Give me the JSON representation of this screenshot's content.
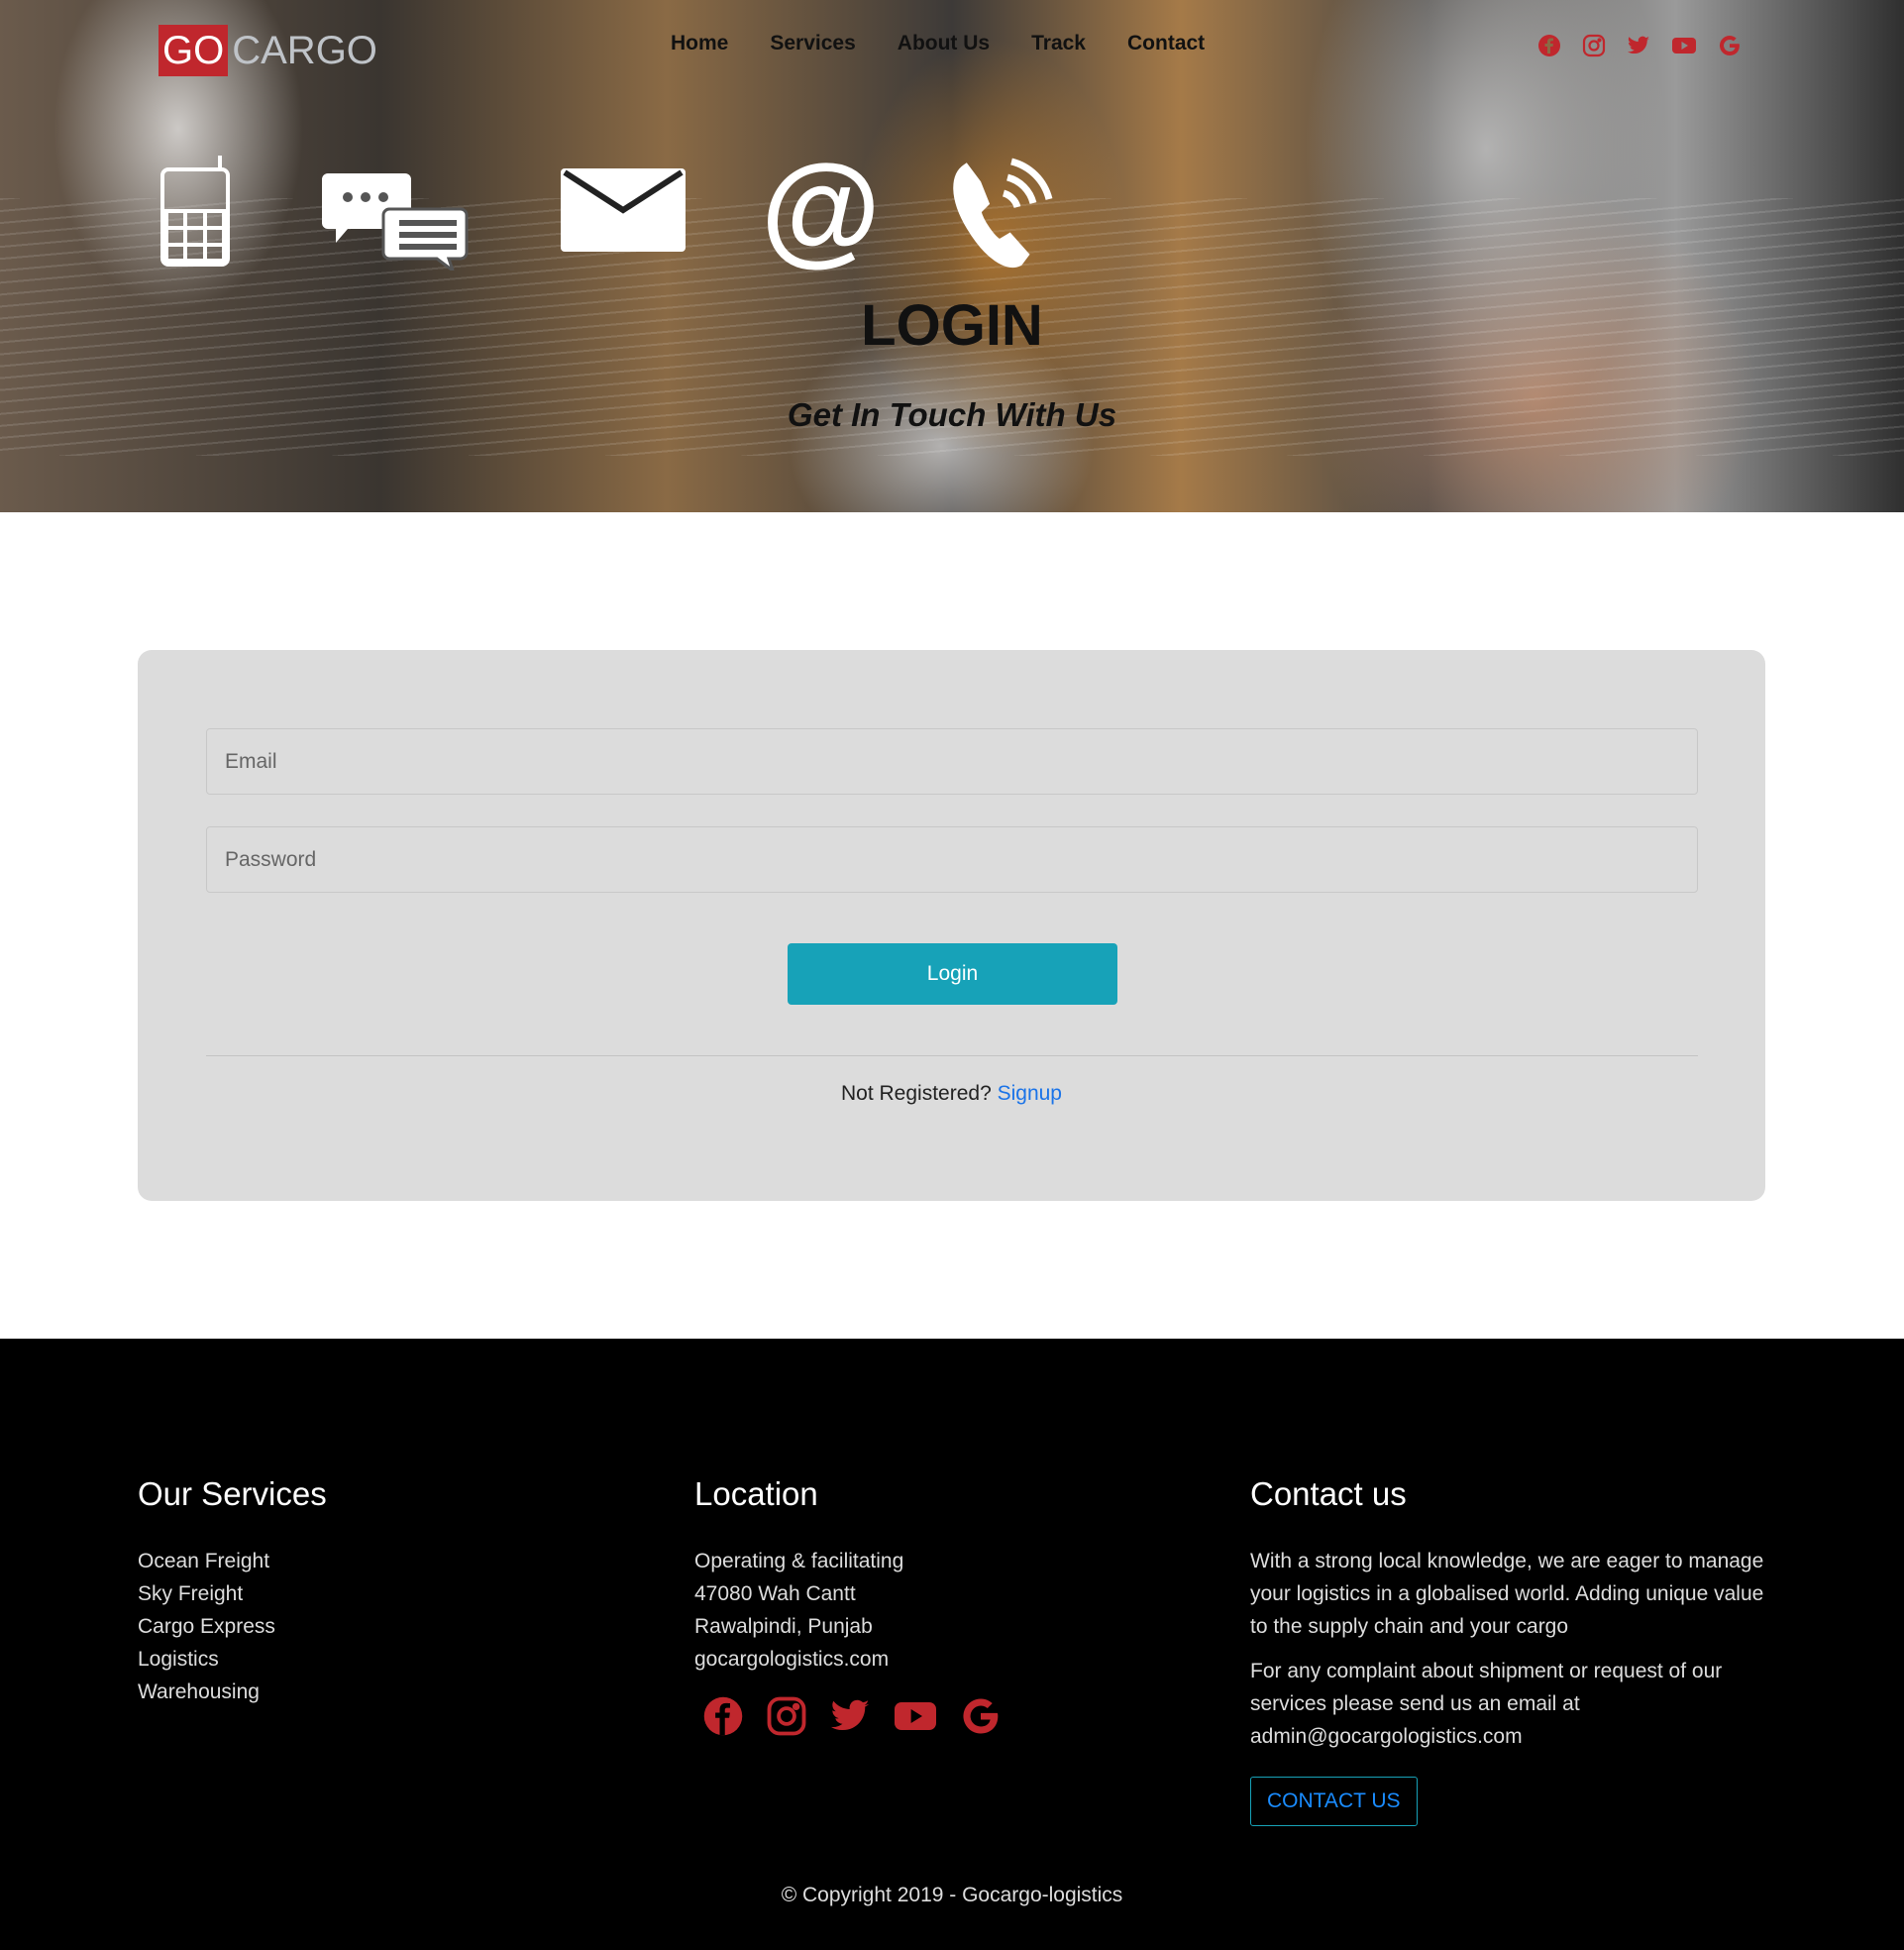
{
  "brand": {
    "go": "GO",
    "cargo": "CARGO"
  },
  "nav": [
    "Home",
    "Services",
    "About Us",
    "Track",
    "Contact"
  ],
  "social": [
    "facebook",
    "instagram",
    "twitter",
    "youtube",
    "google"
  ],
  "hero": {
    "title": "LOGIN",
    "subtitle": "Get In Touch With Us"
  },
  "form": {
    "email_placeholder": "Email",
    "password_placeholder": "Password",
    "login_label": "Login",
    "not_registered": "Not Registered?",
    "signup_label": "Signup"
  },
  "footer": {
    "services": {
      "heading": "Our Services",
      "items": [
        "Ocean Freight",
        "Sky Freight",
        "Cargo Express",
        "Logistics",
        "Warehousing"
      ]
    },
    "location": {
      "heading": "Location",
      "lines": [
        "Operating & facilitating",
        "47080 Wah Cantt",
        "Rawalpindi, Punjab",
        "gocargologistics.com"
      ]
    },
    "contact": {
      "heading": "Contact us",
      "p1": "With a strong local knowledge, we are eager to manage your logistics in a globalised world. Adding unique value to the supply chain and your cargo",
      "p2": "For any complaint about shipment or request of our services please send us an email at admin@gocargologistics.com",
      "button": "CONTACT US"
    },
    "copyright": "© Copyright 2019 - Gocargo-logistics"
  },
  "colors": {
    "accent": "#c0272d",
    "button": "#17a2b8",
    "link": "#1a73e8"
  }
}
